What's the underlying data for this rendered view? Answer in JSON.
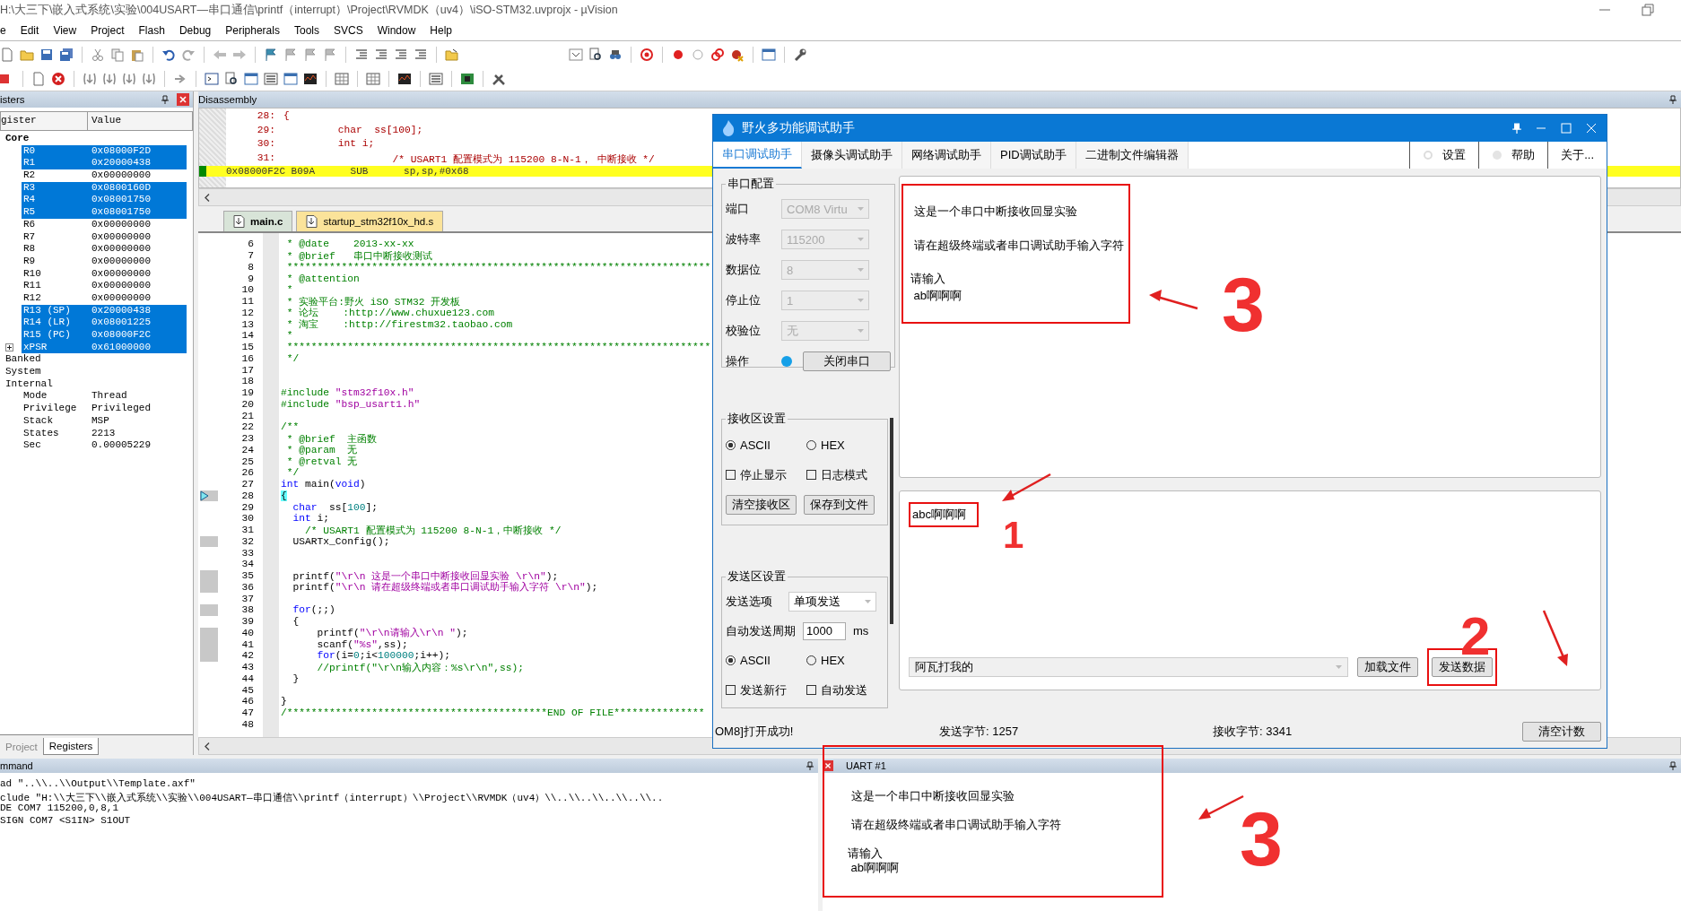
{
  "window": {
    "title": "H:\\大三下\\嵌入式系统\\实验\\004USART—串口通信\\printf（interrupt）\\Project\\RVMDK（uv4）\\iSO-STM32.uvprojx - µVision"
  },
  "menu": [
    "e",
    "Edit",
    "View",
    "Project",
    "Flash",
    "Debug",
    "Peripherals",
    "Tools",
    "SVCS",
    "Window",
    "Help"
  ],
  "registers": {
    "title": "isters",
    "columns": [
      "gister",
      "Value"
    ],
    "tree": [
      {
        "name": "Core",
        "children": [
          {
            "name": "R0",
            "value": "0x08000F2D",
            "selected": true,
            "expandable": false
          },
          {
            "name": "R1",
            "value": "0x20000438",
            "selected": true,
            "expandable": false
          },
          {
            "name": "R2",
            "value": "0x00000000",
            "selected": false,
            "expandable": false
          },
          {
            "name": "R3",
            "value": "0x0800160D",
            "selected": true,
            "expandable": false
          },
          {
            "name": "R4",
            "value": "0x08001750",
            "selected": true,
            "expandable": false
          },
          {
            "name": "R5",
            "value": "0x08001750",
            "selected": true,
            "expandable": false
          },
          {
            "name": "R6",
            "value": "0x00000000",
            "selected": false,
            "expandable": false
          },
          {
            "name": "R7",
            "value": "0x00000000",
            "selected": false,
            "expandable": false
          },
          {
            "name": "R8",
            "value": "0x00000000",
            "selected": false,
            "expandable": false
          },
          {
            "name": "R9",
            "value": "0x00000000",
            "selected": false,
            "expandable": false
          },
          {
            "name": "R10",
            "value": "0x00000000",
            "selected": false,
            "expandable": false
          },
          {
            "name": "R11",
            "value": "0x00000000",
            "selected": false,
            "expandable": false
          },
          {
            "name": "R12",
            "value": "0x00000000",
            "selected": false,
            "expandable": false
          },
          {
            "name": "R13 (SP)",
            "value": "0x20000438",
            "selected": true,
            "expandable": false
          },
          {
            "name": "R14 (LR)",
            "value": "0x08001225",
            "selected": true,
            "expandable": false
          },
          {
            "name": "R15 (PC)",
            "value": "0x08000F2C",
            "selected": true,
            "expandable": false
          },
          {
            "name": "xPSR",
            "value": "0x61000000",
            "selected": true,
            "expandable": true
          }
        ]
      },
      {
        "name": "Banked"
      },
      {
        "name": "System"
      },
      {
        "name": "Internal",
        "children": [
          {
            "name": "Mode",
            "value": "Thread",
            "selected": false,
            "expandable": false
          },
          {
            "name": "Privilege",
            "value": "Privileged",
            "selected": false,
            "expandable": false
          },
          {
            "name": "Stack",
            "value": "MSP",
            "selected": false,
            "expandable": false
          },
          {
            "name": "States",
            "value": "2213",
            "selected": false,
            "expandable": false
          },
          {
            "name": "Sec",
            "value": "0.00005229",
            "selected": false,
            "expandable": false
          }
        ]
      }
    ],
    "tabs": [
      {
        "label": "Project",
        "selected": false
      },
      {
        "label": "Registers",
        "selected": true
      }
    ]
  },
  "disassembly": {
    "title": "Disassembly",
    "lines": [
      {
        "no": "28:",
        "code": "{"
      },
      {
        "no": "29:",
        "code": "         char  ss[100];"
      },
      {
        "no": "30:",
        "code": "         int i;"
      },
      {
        "no": "31:",
        "code": "                  /* USART1 配置模式为 115200 8-N-1， 中断接收 */"
      }
    ],
    "current_instruction": "0x08000F2C B09A      SUB      sp,sp,#0x68"
  },
  "editor": {
    "tabs": [
      {
        "label": "main.c",
        "selected": true
      },
      {
        "label": "startup_stm32f10x_hd.s",
        "selected": false
      }
    ],
    "lines": [
      {
        "no": "6",
        "exec": false,
        "current": false,
        "segs": [
          {
            "kind": "cm",
            "text": " * @date    2013-xx-xx"
          }
        ]
      },
      {
        "no": "7",
        "exec": false,
        "current": false,
        "segs": [
          {
            "kind": "cm",
            "text": " * @brief   串口中断接收测试"
          }
        ]
      },
      {
        "no": "8",
        "exec": false,
        "current": false,
        "segs": [
          {
            "kind": "cm",
            "text": " **********************************************************************"
          }
        ]
      },
      {
        "no": "9",
        "exec": false,
        "current": false,
        "segs": [
          {
            "kind": "cm",
            "text": " * @attention"
          }
        ]
      },
      {
        "no": "10",
        "exec": false,
        "current": false,
        "segs": [
          {
            "kind": "cm",
            "text": " *"
          }
        ]
      },
      {
        "no": "11",
        "exec": false,
        "current": false,
        "segs": [
          {
            "kind": "cm",
            "text": " * 实验平台:野火 iSO STM32 开发板"
          }
        ]
      },
      {
        "no": "12",
        "exec": false,
        "current": false,
        "segs": [
          {
            "kind": "cm",
            "text": " * 论坛    :http://www.chuxue123.com"
          }
        ]
      },
      {
        "no": "13",
        "exec": false,
        "current": false,
        "segs": [
          {
            "kind": "cm",
            "text": " * 淘宝    :http://firestm32.taobao.com"
          }
        ]
      },
      {
        "no": "14",
        "exec": false,
        "current": false,
        "segs": [
          {
            "kind": "cm",
            "text": " *"
          }
        ]
      },
      {
        "no": "15",
        "exec": false,
        "current": false,
        "segs": [
          {
            "kind": "cm",
            "text": " **********************************************************************"
          }
        ]
      },
      {
        "no": "16",
        "exec": false,
        "current": false,
        "segs": [
          {
            "kind": "cm",
            "text": " */"
          }
        ]
      },
      {
        "no": "17",
        "exec": false,
        "current": false
      },
      {
        "no": "18",
        "exec": false,
        "current": false
      },
      {
        "no": "19",
        "exec": false,
        "current": false,
        "segs": [
          {
            "kind": "cm",
            "text": "#include "
          },
          {
            "kind": "str",
            "text": "\"stm32f10x.h\""
          }
        ]
      },
      {
        "no": "20",
        "exec": false,
        "current": false,
        "segs": [
          {
            "kind": "cm",
            "text": "#include "
          },
          {
            "kind": "str",
            "text": "\"bsp_usart1.h\""
          }
        ]
      },
      {
        "no": "21",
        "exec": false,
        "current": false
      },
      {
        "no": "22",
        "exec": false,
        "current": false,
        "segs": [
          {
            "kind": "cm",
            "text": "/**"
          }
        ]
      },
      {
        "no": "23",
        "exec": false,
        "current": false,
        "segs": [
          {
            "kind": "cm",
            "text": " * @brief  主函数"
          }
        ]
      },
      {
        "no": "24",
        "exec": false,
        "current": false,
        "segs": [
          {
            "kind": "cm",
            "text": " * @param  无"
          }
        ]
      },
      {
        "no": "25",
        "exec": false,
        "current": false,
        "segs": [
          {
            "kind": "cm",
            "text": " * @retval 无"
          }
        ]
      },
      {
        "no": "26",
        "exec": false,
        "current": false,
        "segs": [
          {
            "kind": "cm",
            "text": " */"
          }
        ]
      },
      {
        "no": "27",
        "exec": false,
        "current": false,
        "segs": [
          {
            "kind": "kw",
            "text": "int"
          },
          {
            "kind": "pl",
            "text": " main("
          },
          {
            "kind": "kw",
            "text": "void"
          },
          {
            "kind": "pl",
            "text": ")"
          }
        ]
      },
      {
        "no": "28",
        "exec": true,
        "current": true,
        "segs": [
          {
            "kind": "pl",
            "text": "{"
          }
        ]
      },
      {
        "no": "29",
        "exec": false,
        "current": false,
        "segs": [
          {
            "kind": "kw",
            "text": "  char"
          },
          {
            "kind": "pl",
            "text": "  ss["
          },
          {
            "kind": "num",
            "text": "100"
          },
          {
            "kind": "pl",
            "text": "];"
          }
        ]
      },
      {
        "no": "30",
        "exec": false,
        "current": false,
        "segs": [
          {
            "kind": "kw",
            "text": "  int"
          },
          {
            "kind": "pl",
            "text": " i;"
          }
        ]
      },
      {
        "no": "31",
        "exec": false,
        "current": false,
        "segs": [
          {
            "kind": "cm",
            "text": "    /* USART1 配置模式为 115200 8-N-1，中断接收 */"
          }
        ]
      },
      {
        "no": "32",
        "exec": true,
        "current": false,
        "segs": [
          {
            "kind": "pl",
            "text": "  USARTx_Config();"
          }
        ]
      },
      {
        "no": "33",
        "exec": false,
        "current": false
      },
      {
        "no": "34",
        "exec": false,
        "current": false
      },
      {
        "no": "35",
        "exec": true,
        "current": false,
        "segs": [
          {
            "kind": "pl",
            "text": "  printf("
          },
          {
            "kind": "str",
            "text": "\"\\r\\n 这是一个串口中断接收回显实验 \\r\\n\""
          },
          {
            "kind": "pl",
            "text": ");"
          }
        ]
      },
      {
        "no": "36",
        "exec": true,
        "current": false,
        "segs": [
          {
            "kind": "pl",
            "text": "  printf("
          },
          {
            "kind": "str",
            "text": "\"\\r\\n 请在超级终端或者串口调试助手输入字符 \\r\\n\""
          },
          {
            "kind": "pl",
            "text": ");"
          }
        ]
      },
      {
        "no": "37",
        "exec": false,
        "current": false
      },
      {
        "no": "38",
        "exec": true,
        "current": false,
        "segs": [
          {
            "kind": "kw",
            "text": "  for"
          },
          {
            "kind": "pl",
            "text": "(;;)"
          }
        ]
      },
      {
        "no": "39",
        "exec": false,
        "current": false,
        "segs": [
          {
            "kind": "pl",
            "text": "  {"
          }
        ]
      },
      {
        "no": "40",
        "exec": true,
        "current": false,
        "segs": [
          {
            "kind": "pl",
            "text": "      printf("
          },
          {
            "kind": "str",
            "text": "\"\\r\\n请输入\\r\\n \""
          },
          {
            "kind": "pl",
            "text": ");"
          }
        ]
      },
      {
        "no": "41",
        "exec": true,
        "current": false,
        "segs": [
          {
            "kind": "pl",
            "text": "      scanf("
          },
          {
            "kind": "str",
            "text": "\"%s\""
          },
          {
            "kind": "pl",
            "text": ",ss);"
          }
        ]
      },
      {
        "no": "42",
        "exec": true,
        "current": false,
        "segs": [
          {
            "kind": "kw",
            "text": "      for"
          },
          {
            "kind": "pl",
            "text": "(i="
          },
          {
            "kind": "num",
            "text": "0"
          },
          {
            "kind": "pl",
            "text": ";i<"
          },
          {
            "kind": "num",
            "text": "100000"
          },
          {
            "kind": "pl",
            "text": ";i++);"
          }
        ]
      },
      {
        "no": "43",
        "exec": false,
        "current": false,
        "segs": [
          {
            "kind": "cm",
            "text": "      //printf(\"\\r\\n输入内容：%s\\r\\n\",ss);"
          }
        ]
      },
      {
        "no": "44",
        "exec": false,
        "current": false,
        "segs": [
          {
            "kind": "pl",
            "text": "  }"
          }
        ]
      },
      {
        "no": "45",
        "exec": false,
        "current": false
      },
      {
        "no": "46",
        "exec": false,
        "current": false,
        "segs": [
          {
            "kind": "pl",
            "text": "}"
          }
        ]
      },
      {
        "no": "47",
        "exec": false,
        "current": false,
        "segs": [
          {
            "kind": "cm",
            "text": "/*******************************************END OF FILE***************"
          }
        ]
      },
      {
        "no": "48",
        "exec": false,
        "current": false
      }
    ]
  },
  "serial_tool": {
    "title": "野火多功能调试助手",
    "tabs": [
      {
        "label": "串口调试助手",
        "selected": true
      },
      {
        "label": "摄像头调试助手",
        "selected": false
      },
      {
        "label": "网络调试助手",
        "selected": false
      },
      {
        "label": "PID调试助手",
        "selected": false
      },
      {
        "label": "二进制文件编辑器",
        "selected": false
      }
    ],
    "right_tabs": [
      "设置",
      "帮助",
      "关于..."
    ],
    "port_config": {
      "title": "串口配置",
      "fields": [
        {
          "label": "端口",
          "value": "COM8 Virtu"
        },
        {
          "label": "波特率",
          "value": "115200"
        },
        {
          "label": "数据位",
          "value": "8"
        },
        {
          "label": "停止位",
          "value": "1"
        },
        {
          "label": "校验位",
          "value": "无"
        }
      ],
      "action_label": "操作",
      "connected": true,
      "button": "关闭串口"
    },
    "receive_settings": {
      "title": "接收区设置",
      "radios": [
        {
          "label": "ASCII",
          "selected": true
        },
        {
          "label": "HEX",
          "selected": false
        }
      ],
      "checks": [
        {
          "label": "停止显示",
          "checked": false
        },
        {
          "label": "日志模式",
          "checked": false
        }
      ],
      "buttons": [
        "清空接收区",
        "保存到文件"
      ]
    },
    "send_settings": {
      "title": "发送区设置",
      "option_label": "发送选项",
      "option": "单项发送",
      "period_label": "自动发送周期",
      "period": "1000",
      "unit": "ms",
      "radios": [
        {
          "label": "ASCII",
          "selected": true
        },
        {
          "label": "HEX",
          "selected": false
        }
      ],
      "checks": [
        {
          "label": "发送新行",
          "checked": false
        },
        {
          "label": "自动发送",
          "checked": false
        }
      ]
    },
    "received_lines": [
      " 这是一个串口中断接收回显实验",
      " 请在超级终端或者串口调试助手输入字符",
      "请输入",
      " ab啊啊啊"
    ],
    "send_text": "abc啊啊啊",
    "history": "阿瓦打我的",
    "buttons": [
      "加载文件",
      "发送数据"
    ],
    "status": "OM8]打开成功!",
    "sent": "发送字节: 1257",
    "received": "接收字节: 3341",
    "clear_button": "清空计数"
  },
  "command": {
    "title": "mmand",
    "lines": [
      "ad \"..\\\\..\\\\Output\\\\Template.axf\"",
      "clude \"H:\\\\大三下\\\\嵌入式系统\\\\实验\\\\004USART—串口通信\\\\printf（interrupt）\\\\Project\\\\RVMDK（uv4）\\\\..\\\\..\\\\..\\\\..\\\\..",
      "DE COM7 115200,0,8,1",
      "SIGN COM7 <S1IN> S1OUT"
    ]
  },
  "uart": {
    "title": "UART #1",
    "lines": [
      " 这是一个串口中断接收回显实验",
      " 请在超级终端或者串口调试助手输入字符",
      "请输入",
      " ab啊啊啊"
    ]
  },
  "annotations": [
    {
      "text": "3"
    },
    {
      "text": "1"
    },
    {
      "text": "2"
    },
    {
      "text": "3"
    }
  ]
}
